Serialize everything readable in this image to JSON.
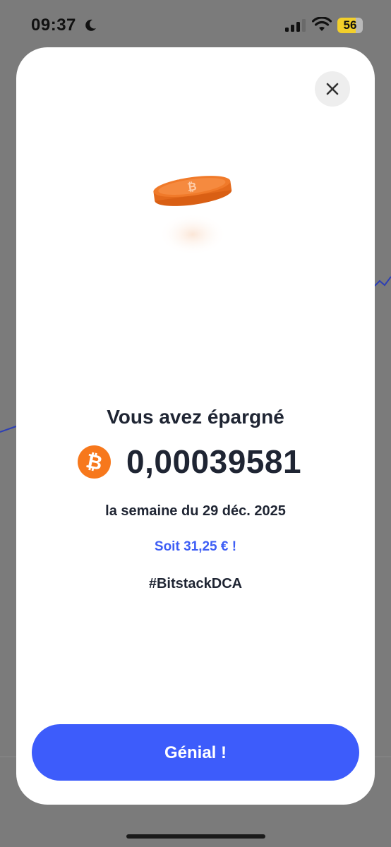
{
  "status_bar": {
    "time": "09:37",
    "battery_level": "56",
    "icons": [
      "moon-icon",
      "signal-icon",
      "wifi-icon",
      "battery-icon"
    ]
  },
  "modal": {
    "close_icon": "close-icon",
    "illustration_icon": "bitcoin-coin-icon",
    "headline": "Vous avez épargné",
    "currency_icon": "bitcoin-icon",
    "amount": "0,00039581",
    "period": "la semaine du 29 déc. 2025",
    "fiat_equivalent": "Soit 31,25 € !",
    "hashtag": "#BitstackDCA",
    "confirm_label": "Génial !"
  },
  "colors": {
    "accent": "#3d5cfb",
    "fiat_text": "#3e5ef5",
    "bitcoin_orange": "#f7781c",
    "text_primary": "#1f2533",
    "backdrop": "#7b7b7b"
  }
}
